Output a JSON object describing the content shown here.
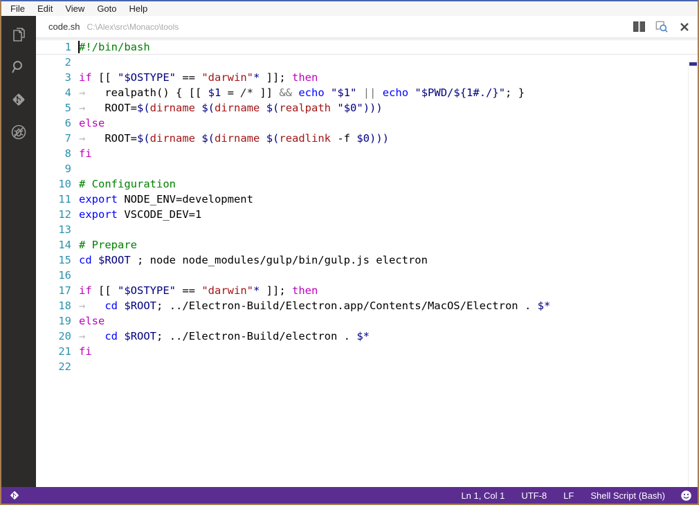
{
  "menubar": {
    "items": [
      "File",
      "Edit",
      "View",
      "Goto",
      "Help"
    ]
  },
  "tabbar": {
    "filename": "code.sh",
    "filepath": "C:\\Alex\\src\\Monaco\\tools"
  },
  "activitybar": {
    "icons": [
      "explorer",
      "search",
      "git",
      "no-bugs"
    ]
  },
  "editor": {
    "cursor_line": 1,
    "cursor_col": 1,
    "lines": [
      {
        "n": 1,
        "current": true,
        "segs": [
          [
            "cmt",
            "#!/bin/bash"
          ]
        ]
      },
      {
        "n": 2,
        "segs": []
      },
      {
        "n": 3,
        "segs": [
          [
            "kw",
            "if"
          ],
          [
            "d",
            " [[ "
          ],
          [
            "var",
            "\"$OSTYPE\""
          ],
          [
            "d",
            " == "
          ],
          [
            "str",
            "\"darwin\""
          ],
          [
            "glob",
            "*"
          ],
          [
            "d",
            " ]]; "
          ],
          [
            "kw",
            "then"
          ]
        ]
      },
      {
        "n": 4,
        "segs": [
          [
            "tab",
            "→"
          ],
          [
            "d",
            "   realpath() { [[ "
          ],
          [
            "var",
            "$1"
          ],
          [
            "d",
            " = "
          ],
          [
            "re",
            "/*"
          ],
          [
            "d",
            " ]] "
          ],
          [
            "op",
            "&&"
          ],
          [
            "d",
            " "
          ],
          [
            "cmd",
            "echo"
          ],
          [
            "d",
            " "
          ],
          [
            "var",
            "\"$1\""
          ],
          [
            "d",
            " "
          ],
          [
            "op",
            "||"
          ],
          [
            "d",
            " "
          ],
          [
            "cmd",
            "echo"
          ],
          [
            "d",
            " "
          ],
          [
            "var",
            "\"$PWD/${1#./}\""
          ],
          [
            "d",
            "; }"
          ]
        ]
      },
      {
        "n": 5,
        "segs": [
          [
            "tab",
            "→"
          ],
          [
            "d",
            "   ROOT="
          ],
          [
            "var",
            "$("
          ],
          [
            "str",
            "dirname"
          ],
          [
            "d",
            " "
          ],
          [
            "var",
            "$("
          ],
          [
            "str",
            "dirname"
          ],
          [
            "d",
            " "
          ],
          [
            "var",
            "$("
          ],
          [
            "str",
            "realpath"
          ],
          [
            "d",
            " "
          ],
          [
            "var",
            "\"$0\""
          ],
          [
            "var",
            ")))"
          ]
        ]
      },
      {
        "n": 6,
        "segs": [
          [
            "kw",
            "else"
          ]
        ]
      },
      {
        "n": 7,
        "segs": [
          [
            "tab",
            "→"
          ],
          [
            "d",
            "   ROOT="
          ],
          [
            "var",
            "$("
          ],
          [
            "str",
            "dirname"
          ],
          [
            "d",
            " "
          ],
          [
            "var",
            "$("
          ],
          [
            "str",
            "dirname"
          ],
          [
            "d",
            " "
          ],
          [
            "var",
            "$("
          ],
          [
            "str",
            "readlink"
          ],
          [
            "d",
            " -f "
          ],
          [
            "var",
            "$0"
          ],
          [
            "var",
            ")))"
          ]
        ]
      },
      {
        "n": 8,
        "segs": [
          [
            "kw",
            "fi"
          ]
        ]
      },
      {
        "n": 9,
        "segs": []
      },
      {
        "n": 10,
        "segs": [
          [
            "cmt",
            "# Configuration"
          ]
        ]
      },
      {
        "n": 11,
        "segs": [
          [
            "cmd",
            "export"
          ],
          [
            "d",
            " NODE_ENV=development"
          ]
        ]
      },
      {
        "n": 12,
        "segs": [
          [
            "cmd",
            "export"
          ],
          [
            "d",
            " VSCODE_DEV=1"
          ]
        ]
      },
      {
        "n": 13,
        "segs": []
      },
      {
        "n": 14,
        "segs": [
          [
            "cmt",
            "# Prepare"
          ]
        ]
      },
      {
        "n": 15,
        "segs": [
          [
            "cmd",
            "cd"
          ],
          [
            "d",
            " "
          ],
          [
            "var",
            "$ROOT"
          ],
          [
            "d",
            " ; node node_modules/gulp/bin/gulp.js electron"
          ]
        ]
      },
      {
        "n": 16,
        "segs": []
      },
      {
        "n": 17,
        "segs": [
          [
            "kw",
            "if"
          ],
          [
            "d",
            " [[ "
          ],
          [
            "var",
            "\"$OSTYPE\""
          ],
          [
            "d",
            " == "
          ],
          [
            "str",
            "\"darwin\""
          ],
          [
            "glob",
            "*"
          ],
          [
            "d",
            " ]]; "
          ],
          [
            "kw",
            "then"
          ]
        ]
      },
      {
        "n": 18,
        "segs": [
          [
            "tab",
            "→"
          ],
          [
            "d",
            "   "
          ],
          [
            "cmd",
            "cd"
          ],
          [
            "d",
            " "
          ],
          [
            "var",
            "$ROOT"
          ],
          [
            "d",
            "; ../Electron-Build/Electron.app/Contents/MacOS/Electron . "
          ],
          [
            "var",
            "$*"
          ]
        ]
      },
      {
        "n": 19,
        "segs": [
          [
            "kw",
            "else"
          ]
        ]
      },
      {
        "n": 20,
        "segs": [
          [
            "tab",
            "→"
          ],
          [
            "d",
            "   "
          ],
          [
            "cmd",
            "cd"
          ],
          [
            "d",
            " "
          ],
          [
            "var",
            "$ROOT"
          ],
          [
            "d",
            "; ../Electron-Build/electron . "
          ],
          [
            "var",
            "$*"
          ]
        ]
      },
      {
        "n": 21,
        "segs": [
          [
            "kw",
            "fi"
          ]
        ]
      },
      {
        "n": 22,
        "segs": []
      }
    ]
  },
  "statusbar": {
    "items": [
      "Ln 1, Col 1",
      "UTF-8",
      "LF",
      "Shell Script (Bash)"
    ]
  },
  "colors": {
    "statusbar_bg": "#5c2d91",
    "activitybar_bg": "#2c2b29",
    "window_border": "#a97e52",
    "window_border_top": "#4565ae",
    "comment": "#008000",
    "keyword": "#bf00bf",
    "command": "#0000ff",
    "variable": "#000080",
    "string": "#a31515",
    "line_number": "#2b91af"
  }
}
